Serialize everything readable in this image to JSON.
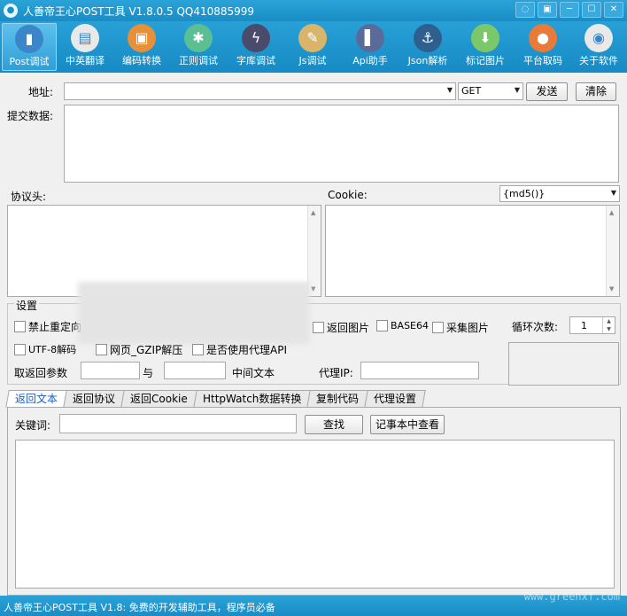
{
  "window": {
    "title": "人善帝王心POST工具 V1.8.0.5 QQ410885999",
    "controls": [
      "◌",
      "▣",
      "─",
      "☐",
      "✕"
    ]
  },
  "toolbar": {
    "items": [
      {
        "label": "Post调试",
        "icon": "chart-bars-icon",
        "glyph": "▮",
        "color": "#3a86c8",
        "active": true
      },
      {
        "label": "中英翻译",
        "icon": "window-icon",
        "glyph": "▤",
        "color": "#e9e9e9"
      },
      {
        "label": "编码转换",
        "icon": "briefcase-icon",
        "glyph": "▣",
        "color": "#e6903a"
      },
      {
        "label": "正则调试",
        "icon": "gear-wheel-icon",
        "glyph": "✱",
        "color": "#5bbf93"
      },
      {
        "label": "字库调试",
        "icon": "lightning-icon",
        "glyph": "ϟ",
        "color": "#4a4a6a"
      },
      {
        "label": "Js调试",
        "icon": "pencil-ruler-icon",
        "glyph": "✎",
        "color": "#d9b56b"
      },
      {
        "label": "Api助手",
        "icon": "book-icon",
        "glyph": "▌",
        "color": "#5a6b9a"
      },
      {
        "label": "Json解析",
        "icon": "anchor-icon",
        "glyph": "⚓",
        "color": "#2f5f8f"
      },
      {
        "label": "标记图片",
        "icon": "download-arrow-icon",
        "glyph": "⬇",
        "color": "#7bc86b"
      },
      {
        "label": "平台取码",
        "icon": "bomb-icon",
        "glyph": "●",
        "color": "#e87a3a"
      },
      {
        "label": "关于软件",
        "icon": "camera-aperture-icon",
        "glyph": "◉",
        "color": "#e9e9e9"
      }
    ]
  },
  "address": {
    "label": "地址:",
    "value": "",
    "method": "GET"
  },
  "buttons": {
    "send": "发送",
    "clear": "清除"
  },
  "post_data": {
    "label": "提交数据:"
  },
  "headers": {
    "label": "协议头:"
  },
  "cookie": {
    "label": "Cookie:",
    "hash": "{md5()}"
  },
  "settings": {
    "title": "设置",
    "no_redirect": "禁止重定向",
    "return_image": "返回图片",
    "base64": "BASE64",
    "collect_image": "采集图片",
    "loop_label": "循环次数:",
    "loop_value": "1",
    "utf8": "UTF-8解码",
    "gzip": "网页_GZIP解压",
    "proxy_api": "是否使用代理API",
    "extract_label": "取返回参数",
    "and_label": "与",
    "middle_label": "中间文本",
    "proxy_ip_label": "代理IP:"
  },
  "tabs": [
    "返回文本",
    "返回协议",
    "返回Cookie",
    "HttpWatch数据转换",
    "复制代码",
    "代理设置"
  ],
  "search": {
    "label": "关键词:",
    "find": "查找",
    "notepad": "记事本中查看"
  },
  "status": {
    "text": "人善帝王心POST工具 V1.8: 免费的开发辅助工具，程序员必备"
  },
  "watermark": "www.greenxf.com"
}
